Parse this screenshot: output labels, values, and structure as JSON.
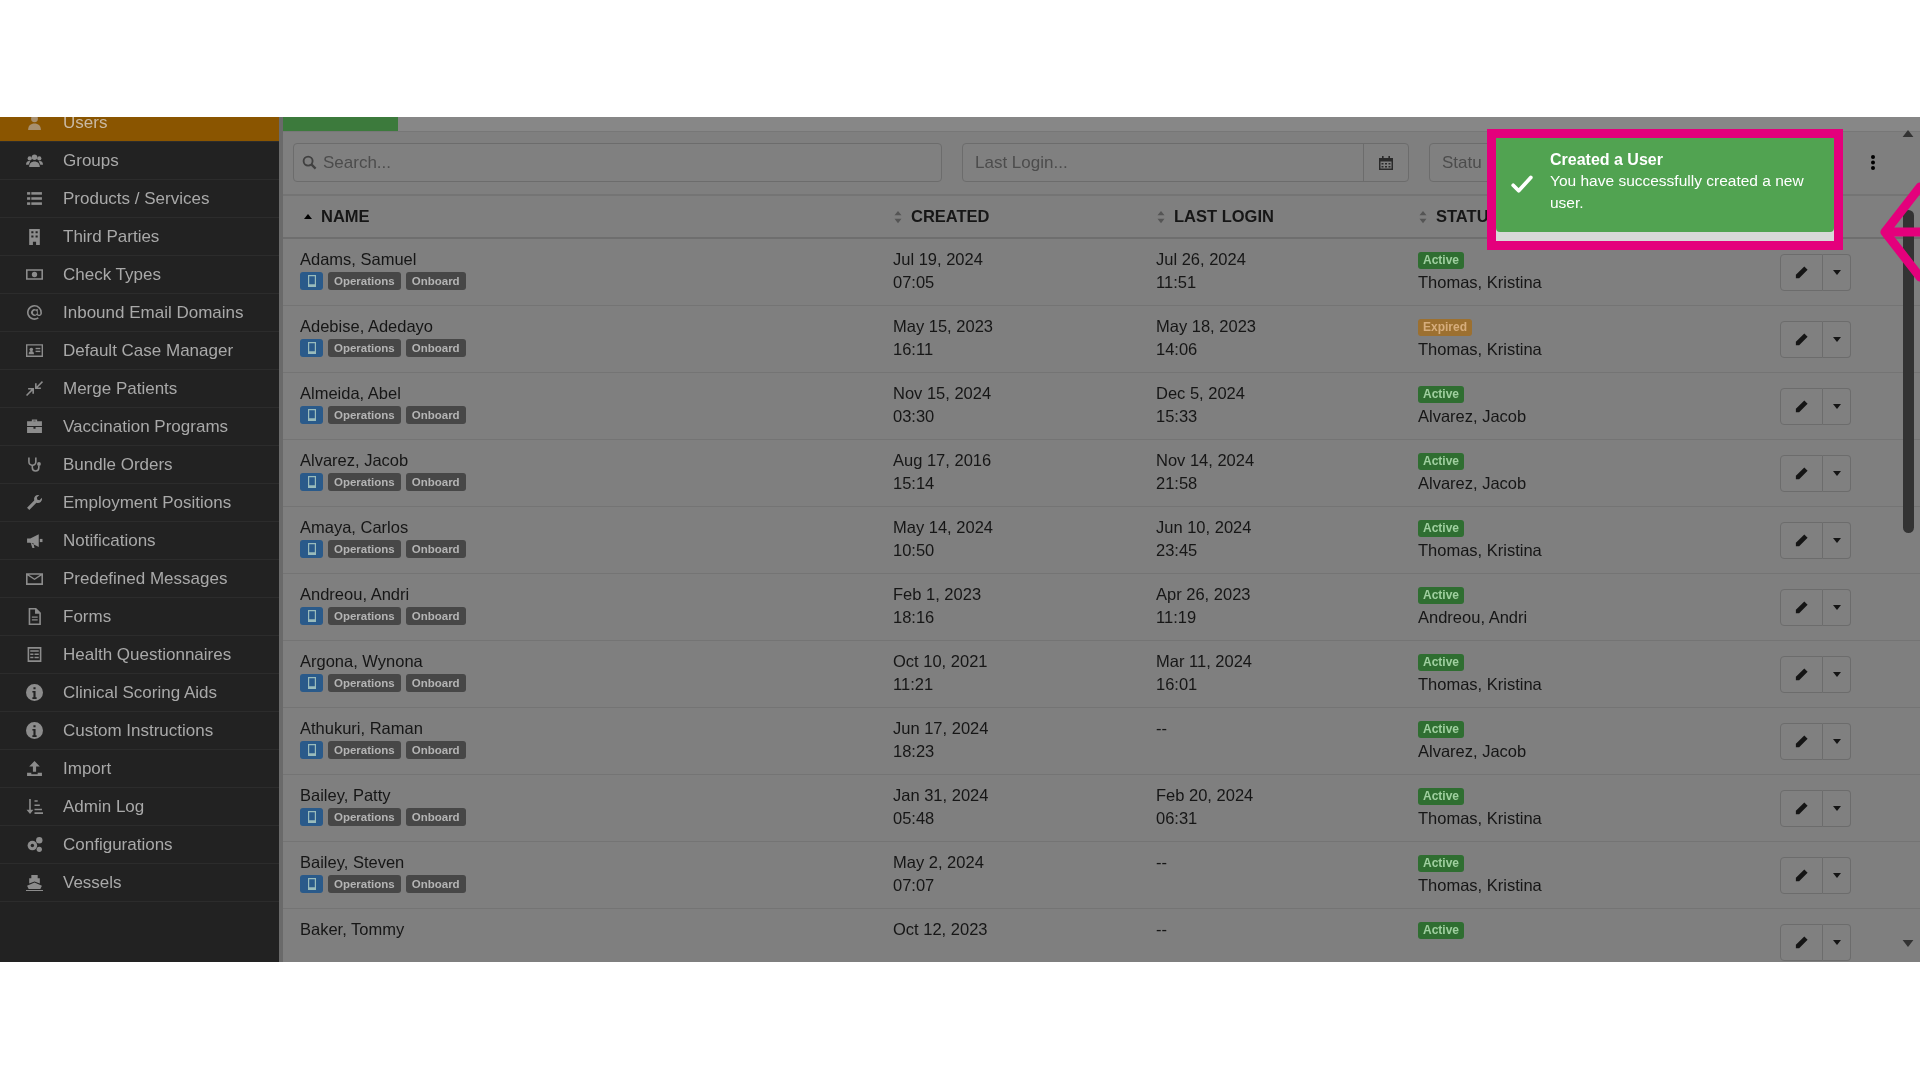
{
  "sidebar": {
    "items": [
      {
        "label": "Users",
        "selected": true
      },
      {
        "label": "Groups",
        "selected": false
      },
      {
        "label": "Products / Services",
        "selected": false
      },
      {
        "label": "Third Parties",
        "selected": false
      },
      {
        "label": "Check Types",
        "selected": false
      },
      {
        "label": "Inbound Email Domains",
        "selected": false
      },
      {
        "label": "Default Case Manager",
        "selected": false
      },
      {
        "label": "Merge Patients",
        "selected": false
      },
      {
        "label": "Vaccination Programs",
        "selected": false
      },
      {
        "label": "Bundle Orders",
        "selected": false
      },
      {
        "label": "Employment Positions",
        "selected": false
      },
      {
        "label": "Notifications",
        "selected": false
      },
      {
        "label": "Predefined Messages",
        "selected": false
      },
      {
        "label": "Forms",
        "selected": false
      },
      {
        "label": "Health Questionnaires",
        "selected": false
      },
      {
        "label": "Clinical Scoring Aids",
        "selected": false
      },
      {
        "label": "Custom Instructions",
        "selected": false
      },
      {
        "label": "Import",
        "selected": false
      },
      {
        "label": "Admin Log",
        "selected": false
      },
      {
        "label": "Configurations",
        "selected": false
      },
      {
        "label": "Vessels",
        "selected": false
      }
    ]
  },
  "loading_bar": {
    "level": 0.07
  },
  "filters": {
    "search": {
      "placeholder": "Search..."
    },
    "last_login": {
      "placeholder": "Last Login..."
    },
    "status": {
      "placeholder": "Statu"
    }
  },
  "table": {
    "columns": [
      {
        "label": "NAME",
        "sorted": true
      },
      {
        "label": "CREATED",
        "sorted": false
      },
      {
        "label": "LAST LOGIN",
        "sorted": false
      },
      {
        "label": "STATU",
        "sorted": false
      }
    ],
    "rows": [
      {
        "name": "Adams, Samuel",
        "tags": [
          "Operations",
          "Onboard"
        ],
        "created": "Jul 19, 2024",
        "created_time": "07:05",
        "last_login": "Jul 26, 2024",
        "last_login_time": "11:51",
        "status": {
          "label": "Active",
          "kind": "active"
        },
        "manager": "Thomas, Kristina"
      },
      {
        "name": "Adebise, Adedayo",
        "tags": [
          "Operations",
          "Onboard"
        ],
        "created": "May 15, 2023",
        "created_time": "16:11",
        "last_login": "May 18, 2023",
        "last_login_time": "14:06",
        "status": {
          "label": "Expired",
          "kind": "expired"
        },
        "manager": "Thomas, Kristina"
      },
      {
        "name": "Almeida, Abel",
        "tags": [
          "Operations",
          "Onboard"
        ],
        "created": "Nov 15, 2024",
        "created_time": "03:30",
        "last_login": "Dec 5, 2024",
        "last_login_time": "15:33",
        "status": {
          "label": "Active",
          "kind": "active"
        },
        "manager": "Alvarez, Jacob"
      },
      {
        "name": "Alvarez, Jacob",
        "tags": [
          "Operations",
          "Onboard"
        ],
        "created": "Aug 17, 2016",
        "created_time": "15:14",
        "last_login": "Nov 14, 2024",
        "last_login_time": "21:58",
        "status": {
          "label": "Active",
          "kind": "active"
        },
        "manager": "Alvarez, Jacob"
      },
      {
        "name": "Amaya, Carlos",
        "tags": [
          "Operations",
          "Onboard"
        ],
        "created": "May 14, 2024",
        "created_time": "10:50",
        "last_login": "Jun 10, 2024",
        "last_login_time": "23:45",
        "status": {
          "label": "Active",
          "kind": "active"
        },
        "manager": "Thomas, Kristina"
      },
      {
        "name": "Andreou, Andri",
        "tags": [
          "Operations",
          "Onboard"
        ],
        "created": "Feb 1, 2023",
        "created_time": "18:16",
        "last_login": "Apr 26, 2023",
        "last_login_time": "11:19",
        "status": {
          "label": "Active",
          "kind": "active"
        },
        "manager": "Andreou, Andri"
      },
      {
        "name": "Argona, Wynona",
        "tags": [
          "Operations",
          "Onboard"
        ],
        "created": "Oct 10, 2021",
        "created_time": "11:21",
        "last_login": "Mar 11, 2024",
        "last_login_time": "16:01",
        "status": {
          "label": "Active",
          "kind": "active"
        },
        "manager": "Thomas, Kristina"
      },
      {
        "name": "Athukuri, Raman",
        "tags": [
          "Operations",
          "Onboard"
        ],
        "created": "Jun 17, 2024",
        "created_time": "18:23",
        "last_login": "--",
        "status": {
          "label": "Active",
          "kind": "active"
        },
        "manager": "Alvarez, Jacob"
      },
      {
        "name": "Bailey, Patty",
        "tags": [
          "Operations",
          "Onboard"
        ],
        "created": "Jan 31, 2024",
        "created_time": "05:48",
        "last_login": "Feb 20, 2024",
        "last_login_time": "06:31",
        "status": {
          "label": "Active",
          "kind": "active"
        },
        "manager": "Thomas, Kristina"
      },
      {
        "name": "Bailey, Steven",
        "tags": [
          "Operations",
          "Onboard"
        ],
        "created": "May 2, 2024",
        "created_time": "07:07",
        "last_login": "--",
        "status": {
          "label": "Active",
          "kind": "active"
        },
        "manager": "Thomas, Kristina"
      },
      {
        "name": "Baker, Tommy",
        "created": "Oct 12, 2023",
        "last_login": "--",
        "status": {
          "label": "Active",
          "kind": "active"
        }
      }
    ]
  },
  "toast": {
    "title": "Created a User",
    "message": "You have successfully created a new user."
  }
}
